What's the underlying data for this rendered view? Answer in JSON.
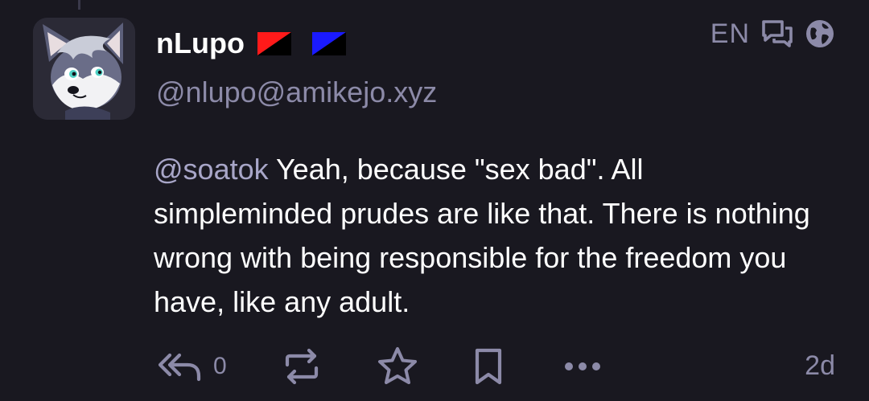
{
  "post": {
    "author": {
      "display_name": "nLupo",
      "handle": "@nlupo@amikejo.xyz",
      "avatar": "wolf-avatar",
      "flags": [
        {
          "name": "red-black-flag",
          "colors": [
            "#ff1a1a",
            "#000000"
          ]
        },
        {
          "name": "blue-black-flag",
          "colors": [
            "#1a1aff",
            "#000000"
          ]
        }
      ]
    },
    "language": "EN",
    "content": {
      "mention": "@soatok",
      "text": " Yeah, because \"sex bad\". All simpleminded prudes are like that. There is nothing wrong with being responsible for the freedom you have, like any adult."
    },
    "actions": {
      "reply_count": "0",
      "time_ago": "2d"
    },
    "icons": [
      "replies-icon",
      "public-globe-icon",
      "reply-all-icon",
      "boost-icon",
      "favourite-star-icon",
      "bookmark-icon",
      "more-icon"
    ]
  },
  "theme": {
    "background": "#191820",
    "text": "#ffffff",
    "muted": "#8c8aa8"
  }
}
